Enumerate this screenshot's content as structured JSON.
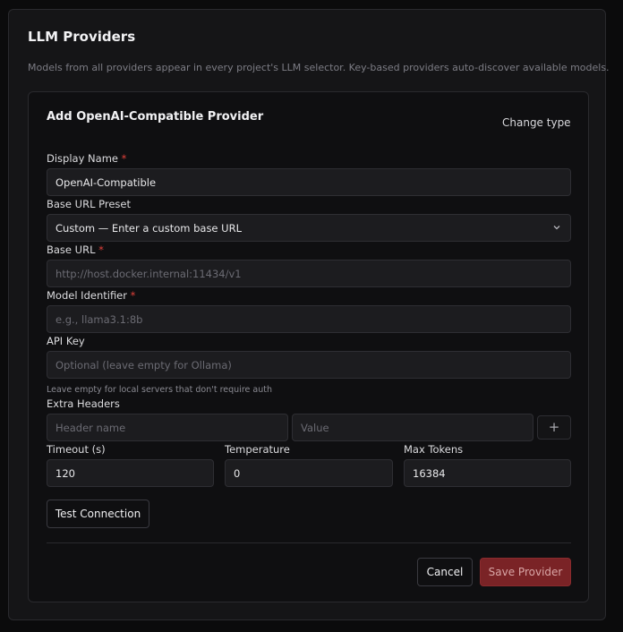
{
  "page": {
    "title": "LLM Providers",
    "description": "Models from all providers appear in every project's LLM selector. Key-based providers auto-discover available models."
  },
  "card": {
    "title": "Add OpenAI-Compatible Provider",
    "change_type": "Change type"
  },
  "fields": {
    "display_name": {
      "label": "Display Name",
      "value": "OpenAI-Compatible"
    },
    "base_url_preset": {
      "label": "Base URL Preset",
      "selected": "Custom — Enter a custom base URL"
    },
    "base_url": {
      "label": "Base URL",
      "placeholder": "http://host.docker.internal:11434/v1"
    },
    "model_identifier": {
      "label": "Model Identifier",
      "placeholder": "e.g., llama3.1:8b"
    },
    "api_key": {
      "label": "API Key",
      "placeholder": "Optional (leave empty for Ollama)",
      "hint": "Leave empty for local servers that don't require auth"
    },
    "extra_headers": {
      "label": "Extra Headers",
      "name_placeholder": "Header name",
      "value_placeholder": "Value",
      "add_label": "+"
    },
    "timeout": {
      "label": "Timeout (s)",
      "value": "120"
    },
    "temperature": {
      "label": "Temperature",
      "value": "0"
    },
    "max_tokens": {
      "label": "Max Tokens",
      "value": "16384"
    }
  },
  "required_marker": "*",
  "buttons": {
    "test_connection": "Test Connection",
    "cancel": "Cancel",
    "save": "Save Provider"
  },
  "icons": {
    "preset_dropdown": "chevron-down-icon"
  },
  "colors": {
    "required": "#e0403a",
    "save_bg": "#7a2326"
  }
}
